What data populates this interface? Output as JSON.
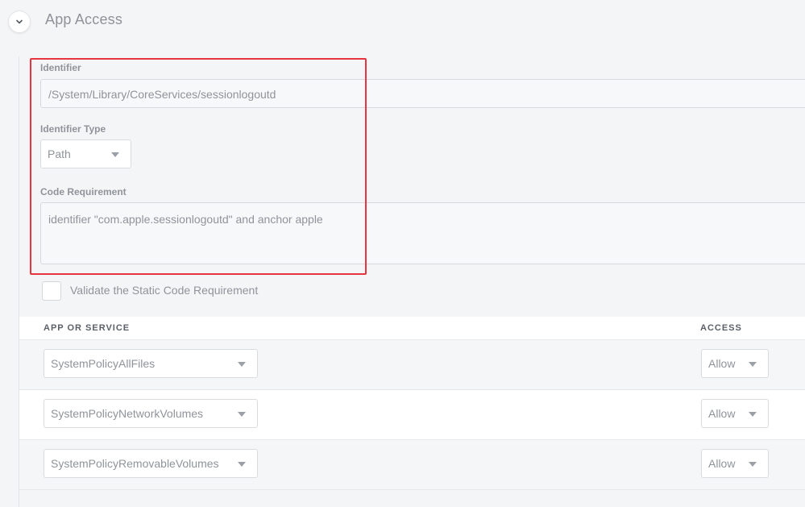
{
  "section": {
    "title": "App Access"
  },
  "identifier": {
    "label": "Identifier",
    "value": "/System/Library/CoreServices/sessionlogoutd"
  },
  "identifier_type": {
    "label": "Identifier Type",
    "selected": "Path"
  },
  "code_requirement": {
    "label": "Code Requirement",
    "value": "identifier \"com.apple.sessionlogoutd\" and anchor apple"
  },
  "validate": {
    "label": "Validate the Static Code Requirement",
    "checked": false
  },
  "table": {
    "headers": {
      "service": "APP OR SERVICE",
      "access": "ACCESS"
    },
    "rows": [
      {
        "service": "SystemPolicyAllFiles",
        "access": "Allow"
      },
      {
        "service": "SystemPolicyNetworkVolumes",
        "access": "Allow"
      },
      {
        "service": "SystemPolicyRemovableVolumes",
        "access": "Allow"
      }
    ]
  },
  "colors": {
    "highlight": "#e8343f",
    "background": "#f4f5f6",
    "text": "#8f949a",
    "header_text": "#5b6068"
  },
  "icons": {
    "collapse": "chevron-down-icon",
    "dropdown": "caret-down-icon"
  }
}
